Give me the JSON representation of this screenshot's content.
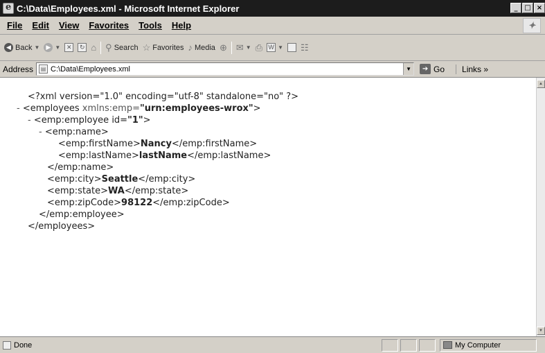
{
  "window": {
    "title": "C:\\Data\\Employees.xml - Microsoft Internet Explorer",
    "buttons": [
      "_",
      "□",
      "×"
    ]
  },
  "menu": [
    "File",
    "Edit",
    "View",
    "Favorites",
    "Tools",
    "Help"
  ],
  "toolbar": {
    "back": "Back",
    "search": "Search",
    "favorites": "Favorites",
    "media": "Media"
  },
  "address": {
    "label": "Address",
    "value": "C:\\Data\\Employees.xml",
    "go": "Go",
    "links": "Links »"
  },
  "xml_lines": [
    {
      "prefix": "",
      "text": "<?xml version=\"1.0\" encoding=\"utf-8\" standalone=\"no\" ?>"
    },
    {
      "prefix": "- ",
      "tag_open": "<employees ",
      "attr": "xmlns:emp=",
      "value": "\"urn:employees-wrox\"",
      "tag_close": ">"
    },
    {
      "prefix": "- ",
      "tag_open": "<emp:employee id=",
      "value": "\"1\"",
      "tag_close": ">"
    },
    {
      "prefix": "- ",
      "text": "<emp:name>"
    },
    {
      "open": "<emp:firstName>",
      "value": "Nancy",
      "close": "</emp:firstName>"
    },
    {
      "open": "<emp:lastName>",
      "value": "lastName",
      "close": "</emp:lastName>"
    },
    {
      "text": "</emp:name>"
    },
    {
      "open": "<emp:city>",
      "value": "Seattle",
      "close": "</emp:city>"
    },
    {
      "open": "<emp:state>",
      "value": "WA",
      "close": "</emp:state>"
    },
    {
      "open": "<emp:zipCode>",
      "value": "98122",
      "close": "</emp:zipCode>"
    },
    {
      "text": "</emp:employee>"
    },
    {
      "text": "</employees>"
    }
  ],
  "status": {
    "text": "Done",
    "zone": "My Computer"
  }
}
